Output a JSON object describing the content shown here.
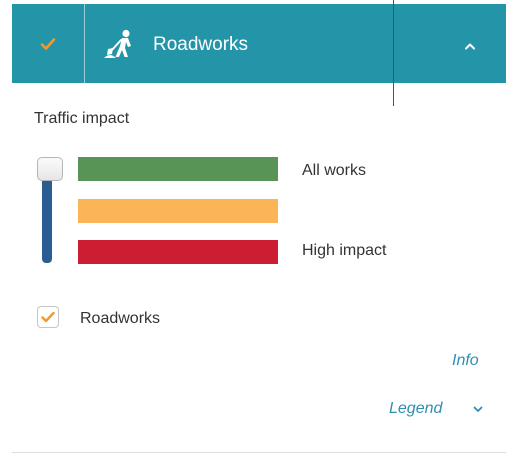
{
  "header": {
    "title": "Roadworks",
    "checked": true,
    "icon": "roadworks-worker-icon",
    "expand_icon": "chevron-up-icon"
  },
  "traffic_impact": {
    "title": "Traffic impact",
    "slider_level": 1.0,
    "levels": [
      {
        "label": "All works",
        "color": "#579456"
      },
      {
        "label": "",
        "color": "#fbb556"
      },
      {
        "label": "High impact",
        "color": "#cb1e33"
      }
    ]
  },
  "filter": {
    "label": "Roadworks",
    "checked": true
  },
  "links": {
    "info": "Info",
    "legend": "Legend",
    "legend_icon": "chevron-down-icon"
  },
  "colors": {
    "header_bg": "#2494a8",
    "check_orange": "#f29a2e",
    "link": "#2f8fb2",
    "slider_track": "#2a5d92"
  }
}
